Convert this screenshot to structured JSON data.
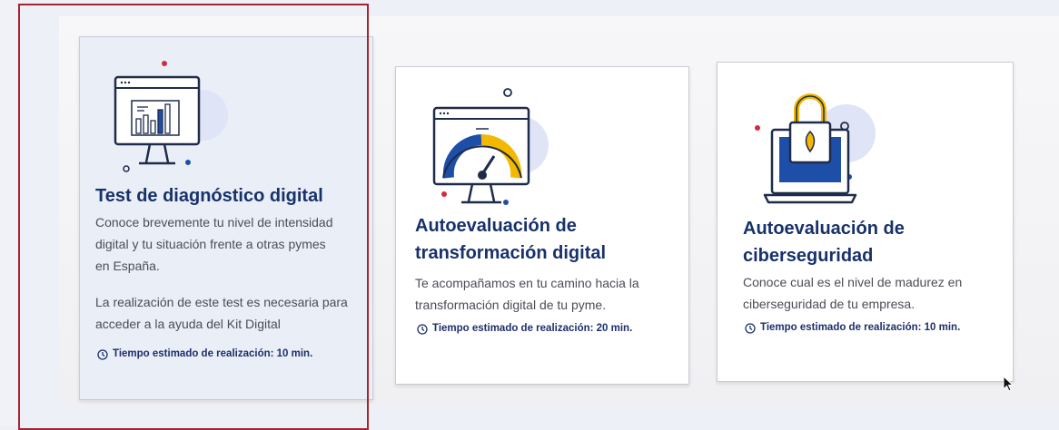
{
  "cards": [
    {
      "title": "Test de diagnóstico digital",
      "description": "Conoce brevemente tu nivel de intensidad digital y tu situación frente a otras pymes en España.",
      "note": "La realización de este test es necesaria para acceder a la ayuda del Kit Digital",
      "time": "Tiempo estimado de realización: 10 min.",
      "icon": "monitor-bar-chart-icon",
      "selected": true
    },
    {
      "title": "Autoevaluación de transformación digital",
      "description": "Te acompañamos en tu camino hacia la transformación digital de tu pyme.",
      "time": "Tiempo estimado de realización: 20 min.",
      "icon": "monitor-gauge-icon"
    },
    {
      "title": "Autoevaluación de ciberseguridad",
      "description": "Conoce cual es el nivel de madurez en ciberseguridad de tu empresa.",
      "time": "Tiempo estimado de realización: 10 min.",
      "icon": "laptop-padlock-icon"
    }
  ],
  "colors": {
    "title": "#17316b",
    "accent_blue": "#1e4fa8",
    "accent_yellow": "#f3b800",
    "highlight_border": "#a5252e",
    "selected_card_bg": "#eaeff7"
  }
}
